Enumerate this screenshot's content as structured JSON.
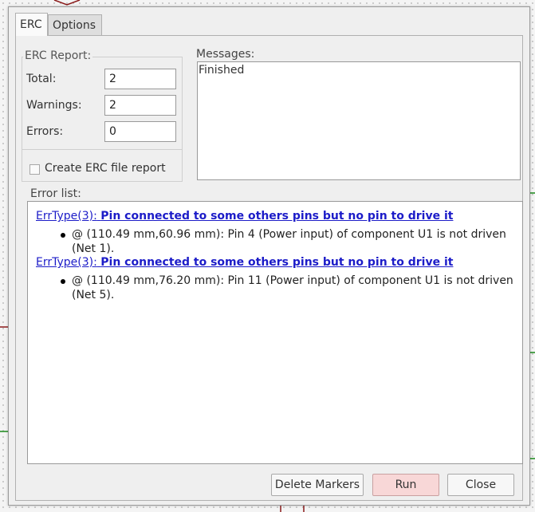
{
  "tabs": {
    "erc": "ERC",
    "options": "Options"
  },
  "erc_report": {
    "title": "ERC Report:",
    "total_label": "Total:",
    "total_value": "2",
    "warnings_label": "Warnings:",
    "warnings_value": "2",
    "errors_label": "Errors:",
    "errors_value": "0",
    "create_file_label": "Create ERC file report",
    "create_file_checked": false
  },
  "messages": {
    "label": "Messages:",
    "content": "Finished"
  },
  "error_list": {
    "label": "Error list:",
    "items": [
      {
        "type": "ErrType(3):",
        "title": "Pin connected to some others pins but no pin to drive it",
        "detail": "@ (110.49 mm,60.96 mm): Pin 4 (Power input) of component U1 is not driven (Net 1)."
      },
      {
        "type": "ErrType(3):",
        "title": "Pin connected to some others pins but no pin to drive it",
        "detail": "@ (110.49 mm,76.20 mm): Pin 11 (Power input) of component U1 is not driven (Net 5)."
      }
    ]
  },
  "buttons": {
    "delete_markers": "Delete Markers",
    "run": "Run",
    "close": "Close"
  },
  "colors": {
    "link": "#1c1cc8",
    "run_button": "#f8d7d7",
    "wire_red": "#8b1a1a",
    "wire_green": "#1a8a1a"
  }
}
